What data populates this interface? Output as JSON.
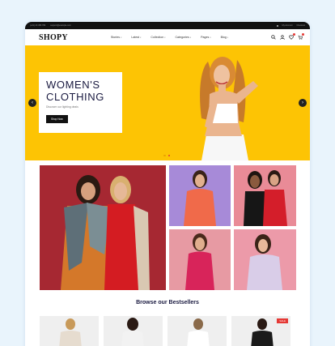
{
  "topbar": {
    "left_items": [
      "(+01) 23 456 789",
      "support@example.com"
    ],
    "right_items": [
      "My Account",
      "Checkout"
    ]
  },
  "header": {
    "logo": "SHOPY",
    "nav": [
      "Stories",
      "Latest",
      "Collection",
      "Categories",
      "Pages",
      "Blog"
    ]
  },
  "hero": {
    "title_line1": "WOMEN'S",
    "title_line2": "CLOTHING",
    "subtitle": "Discover our lighting deals",
    "button": "Shop Now",
    "prev_label": "‹",
    "next_label": "›",
    "slides_total": 2,
    "active_slide": 2
  },
  "bestsellers": {
    "title": "Browse our Bestsellers",
    "badge": "SALE"
  },
  "colors": {
    "accent": "#fdc404",
    "brand_dark": "#1a1a40",
    "badge_red": "#e53935",
    "tile_burgundy": "#a62832",
    "tile_lilac": "#a78ad8",
    "tile_pink": "#e98b97",
    "tile_rose": "#e79aa3",
    "tile_blush": "#ec9aa9"
  }
}
